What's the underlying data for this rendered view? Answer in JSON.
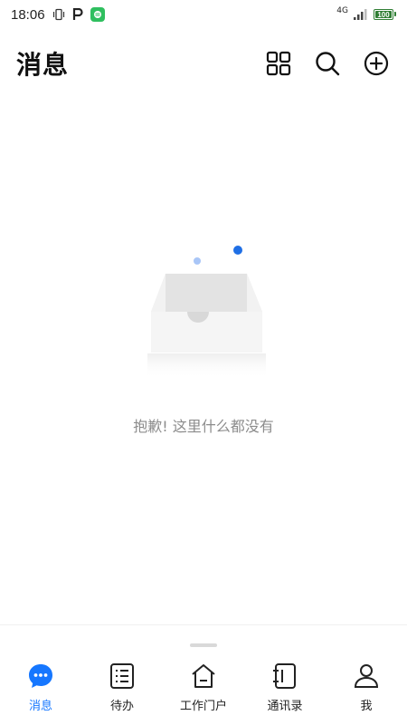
{
  "status_bar": {
    "time": "18:06",
    "network": "4G",
    "battery": "100",
    "battery_level_percent": 100,
    "battery_color": "#2e7d32",
    "app_badge_color": "#2fbf5f"
  },
  "header": {
    "title": "消息",
    "actions": [
      {
        "icon": "grid-icon",
        "name": "apps"
      },
      {
        "icon": "search-icon",
        "name": "search"
      },
      {
        "icon": "add-circle-icon",
        "name": "add"
      }
    ]
  },
  "empty_state": {
    "message": "抱歉! 这里什么都没有",
    "dot_color": "#1f6fe5",
    "dot_light_color": "#a9c6f7"
  },
  "bottom_nav": {
    "active_color": "#1677ff",
    "items": [
      {
        "label": "消息",
        "icon": "chat-bubble-icon",
        "active": true
      },
      {
        "label": "待办",
        "icon": "todo-list-icon",
        "active": false
      },
      {
        "label": "工作门户",
        "icon": "home-icon",
        "active": false
      },
      {
        "label": "通讯录",
        "icon": "contacts-book-icon",
        "active": false
      },
      {
        "label": "我",
        "icon": "user-icon",
        "active": false
      }
    ]
  }
}
